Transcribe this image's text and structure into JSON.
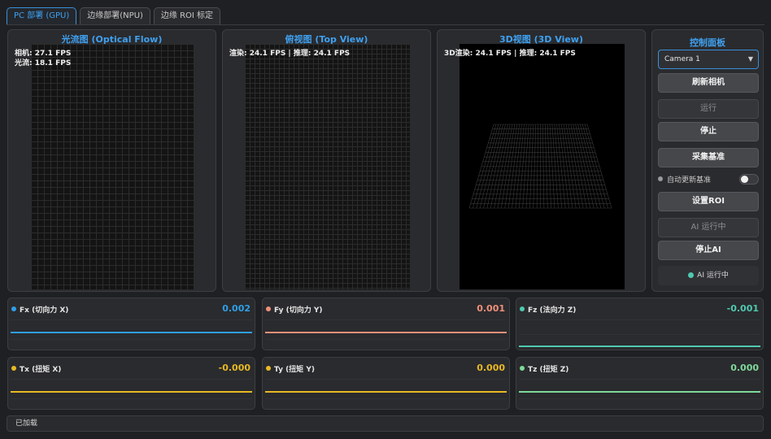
{
  "tabs": [
    {
      "label": "PC 部署 (GPU)",
      "active": true
    },
    {
      "label": "边缘部署(NPU)",
      "active": false
    },
    {
      "label": "边缘 ROI 标定",
      "active": false
    }
  ],
  "views": {
    "optical_flow": {
      "title": "光流图 (Optical Flow)",
      "overlay_line1": "相机: 27.1 FPS",
      "overlay_line2": "光流: 18.1 FPS"
    },
    "top_view": {
      "title": "俯视图 (Top View)",
      "overlay": "渲染: 24.1 FPS | 推理: 24.1 FPS"
    },
    "view_3d": {
      "title": "3D视图 (3D View)",
      "overlay": "3D渲染: 24.1 FPS | 推理: 24.1 FPS"
    }
  },
  "control_panel": {
    "title": "控制面板",
    "camera_select": "Camera 1",
    "refresh_camera": "刷新相机",
    "run": "运行",
    "stop": "停止",
    "collect_baseline": "采集基准",
    "auto_update_label": "自动更新基准",
    "auto_update_on": false,
    "set_roi": "设置ROI",
    "ai_running_button": "AI 运行中",
    "stop_ai": "停止AI",
    "ai_status": "AI 运行中"
  },
  "forces": [
    {
      "label": "Fx (切向力 X)",
      "value": "0.002",
      "color": "#2f9fe8"
    },
    {
      "label": "Fy (切向力 Y)",
      "value": "0.001",
      "color": "#f0907a"
    },
    {
      "label": "Fz (法向力 Z)",
      "value": "-0.001",
      "color": "#4fc9b0"
    },
    {
      "label": "Tx (扭矩 X)",
      "value": "-0.000",
      "color": "#e8b923"
    },
    {
      "label": "Ty (扭矩 Y)",
      "value": "0.000",
      "color": "#e8b923"
    },
    {
      "label": "Tz (扭矩 Z)",
      "value": "0.000",
      "color": "#7ed99a"
    }
  ],
  "status_bar": "已加载"
}
